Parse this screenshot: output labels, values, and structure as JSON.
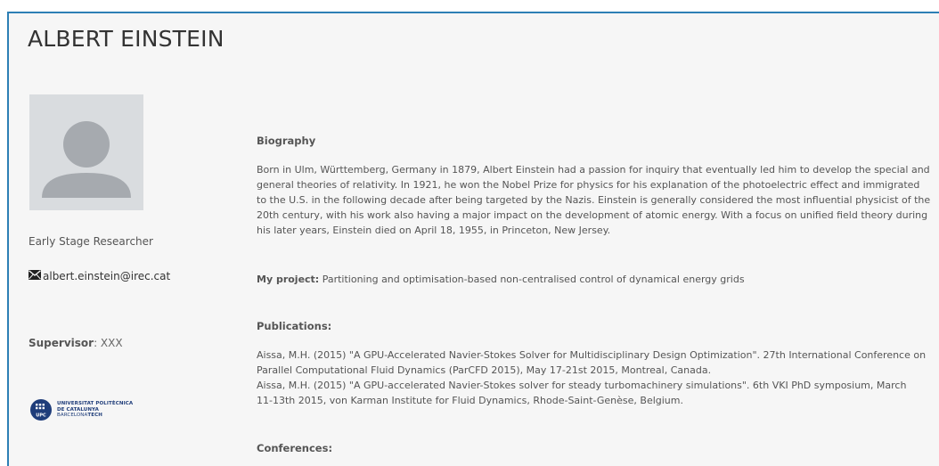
{
  "profile": {
    "name": "ALBERT EINSTEIN",
    "role": "Early Stage Researcher",
    "email": "albert.einstein@irec.cat",
    "supervisor_label": "Supervisor",
    "supervisor_value": ": XXX"
  },
  "logo": {
    "line1": "UNIVERSITAT POLITÈCNICA",
    "line2": "DE CATALUNYA",
    "line3_a": "BARCELONA",
    "line3_b": "TECH",
    "mark": "UPC"
  },
  "biography": {
    "heading": "Biography",
    "lines": [
      "Born in Ulm, Württemberg, Germany in 1879, Albert Einstein had a passion for inquiry that eventually led him to develop the special and",
      "general theories of relativity. In 1921, he won the Nobel Prize for physics for his explanation of the photoelectric effect and immigrated",
      "to the U.S. in the following decade after being targeted by the Nazis. Einstein is generally considered the most influential physicist of the",
      "20th century, with his work also having a major impact on the development of atomic energy. With a focus on unified field theory during",
      "his later years, Einstein died on April 18, 1955, in Princeton, New Jersey."
    ]
  },
  "project": {
    "label": "My project:",
    "text": " Partitioning and optimisation-based non-centralised control of dynamical energy grids"
  },
  "publications": {
    "heading": "Publications:",
    "lines": [
      "Aissa, M.H. (2015) \"A GPU-Accelerated Navier-Stokes Solver for Multidisciplinary Design Optimization\". 27th International Conference on",
      "Parallel Computational Fluid Dynamics (ParCFD 2015), May 17-21st 2015, Montreal, Canada.",
      "Aissa, M.H. (2015) \"A GPU-accelerated Navier-Stokes solver for steady turbomachinery simulations\". 6th VKI PhD symposium, March",
      "11-13th 2015, von Karman Institute for Fluid Dynamics, Rhode-Saint-Genèse, Belgium."
    ]
  },
  "conferences": {
    "heading": "Conferences:"
  },
  "colors": {
    "accent_border": "#2d7fb5",
    "panel_bg": "#f6f6f6",
    "avatar_bg": "#d9dcdf",
    "avatar_figure": "#a6aaaf",
    "logo_blue": "#1f3d7a"
  },
  "icons": {
    "email": "envelope-icon",
    "avatar": "user-silhouette-icon",
    "logo": "upc-logo-icon"
  }
}
